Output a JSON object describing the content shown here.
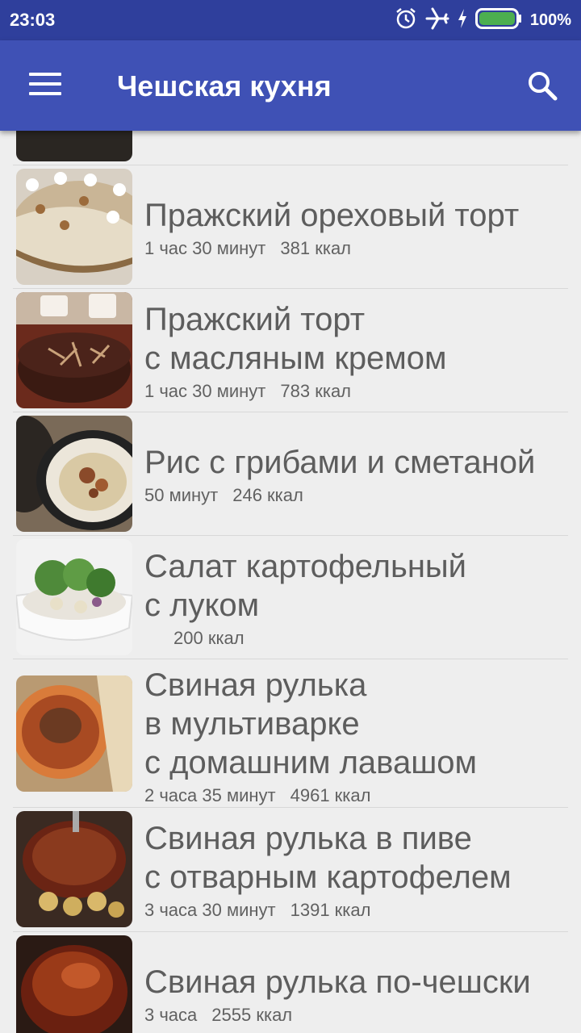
{
  "status": {
    "time": "23:03",
    "battery": "100%",
    "battery_color": "#4caf50"
  },
  "appbar": {
    "title": "Чешская кухня",
    "color": "#3f51b5"
  },
  "recipes": [
    {
      "title": "Пражский ореховый торт",
      "time": "1 час 30 минут",
      "kcal": "381 ккал"
    },
    {
      "title": "Пражский торт\nс масляным кремом",
      "time": "1 час 30 минут",
      "kcal": "783 ккал"
    },
    {
      "title": "Рис с грибами и сметаной",
      "time": "50 минут",
      "kcal": "246 ккал"
    },
    {
      "title": "Салат картофельный\nс луком",
      "time": "",
      "kcal": "200 ккал"
    },
    {
      "title": "Свиная рулька\nв мультиварке\nс домашним лавашом",
      "time": "2 часа 35 минут",
      "kcal": "4961 ккал"
    },
    {
      "title": "Свиная рулька в пиве\nс отварным картофелем",
      "time": "3 часа 30 минут",
      "kcal": "1391 ккал"
    },
    {
      "title": "Свиная рулька по-чешски",
      "time": "3 часа",
      "kcal": "2555 ккал"
    }
  ]
}
